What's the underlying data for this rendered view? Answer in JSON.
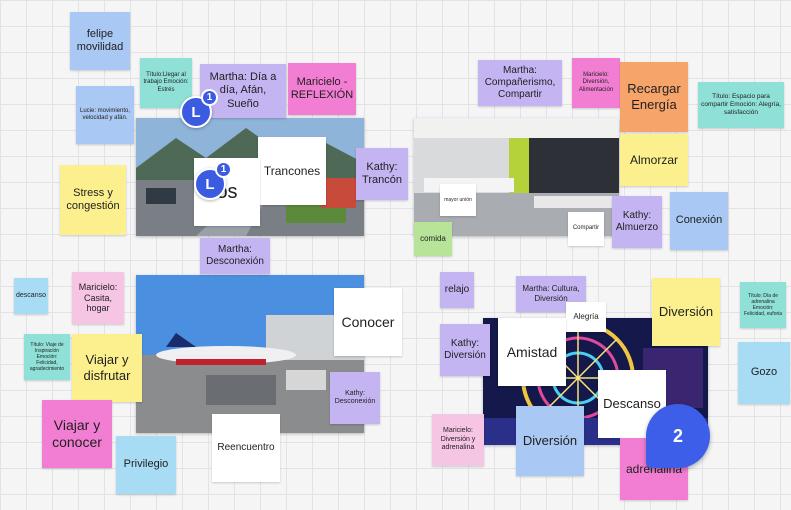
{
  "colors": {
    "blue": "#a9c8f3",
    "yellow": "#fbf08d",
    "pink": "#f6a8d8",
    "magenta": "#f27ed3",
    "purple": "#c4b4f2",
    "violet": "#b79ff2",
    "teal": "#8fe0d6",
    "white": "#ffffff",
    "lightpink": "#f7c5e4",
    "orange": "#f6a46a",
    "green": "#b8e49a",
    "cyan": "#a7dcf4"
  },
  "notes": {
    "felipe": "felipe movilidad",
    "lucie": "Lucie: movimiento, velocidad y afán.",
    "titulo_llegar": "Título:Llegar al trabajo Emoción: Estrés",
    "martha_dia": "Martha: Día a día, Afán, Sueño",
    "maricielo_reflexion": "Maricielo -REFLEXIÓN",
    "stress": "Stress y congestión",
    "trancones": "Trancones",
    "os": "os",
    "kathy_trancon": "Kathy: Trancón",
    "martha_desconexion": "Martha: Desconexión",
    "martha_companerismo": "Martha: Compañerismo, Compartir",
    "maricielo_diversion_alim": "Maricielo: Diversión, Alimentación",
    "recargar": "Recargar Energía",
    "titulo_espacio": "Título: Espacio para compartir Emoción: Alegría, satisfacción",
    "almorzar": "Almorzar",
    "conexion": "Conexión",
    "kathy_almuerzo": "Kathy: Almuerzo",
    "compartir": "Compartir",
    "comida": "comida",
    "mayor_unión": "mayor unión",
    "descanso_small": "descanso",
    "maricielo_casita": "Maricielo: Casita, hogar",
    "titulo_viaje": "Título: Viaje de Inspiración Emoción: Felicidad, agradecimiento",
    "viajar_disfrutar": "Viajar y disfrutar",
    "viajar_conocer": "Viajar y conocer",
    "privilegio": "Privilegio",
    "reencuentro": "Reencuentro",
    "conocer": "Conocer",
    "kathy_desconexion": "Kathy: Desconexión",
    "relajo": "relajo",
    "martha_cultura": "Martha: Cultura, Diversión",
    "alegria": "Alegría",
    "diversion_yellow": "Diversión",
    "titulo_dia": "Título: Día de adrenalina Emoción: Felicidad, euforia",
    "kathy_diversion": "Kathy: Diversión",
    "amistad": "Amistad",
    "gozo": "Gozo",
    "descanso_white": "Descanso",
    "maricielo_adrenalina": "Maricielo: Diversión y adrenalina",
    "diversion_blue": "Diversión",
    "adrenalina": "adrenalina"
  },
  "avatars": [
    {
      "initial": "L",
      "count": "1"
    },
    {
      "initial": "L",
      "count": "1"
    }
  ],
  "comment_count": "2"
}
